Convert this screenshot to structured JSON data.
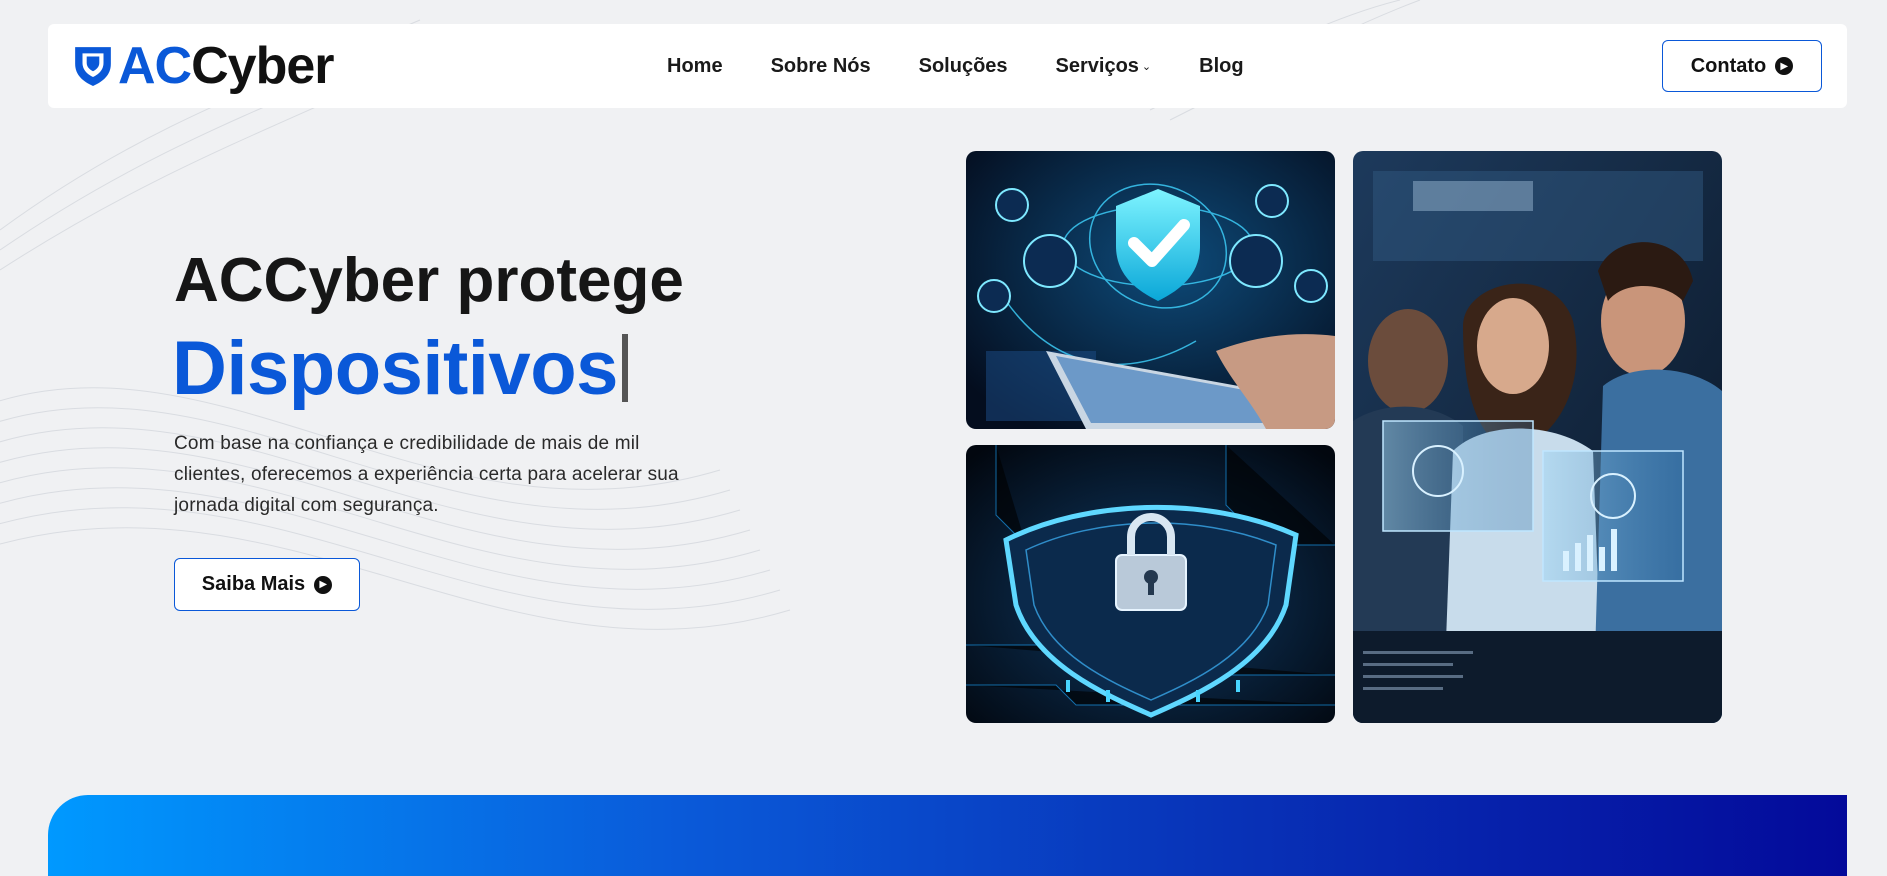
{
  "brand": {
    "prefix": "AC",
    "suffix": "Cyber",
    "accent": "#0a58d8"
  },
  "nav": {
    "items": [
      {
        "label": "Home"
      },
      {
        "label": "Sobre Nós"
      },
      {
        "label": "Soluções"
      },
      {
        "label": "Serviços",
        "has_dropdown": true
      },
      {
        "label": "Blog"
      }
    ],
    "contact_label": "Contato"
  },
  "hero": {
    "title_line1": "ACCyber protege",
    "title_highlight": "Dispositivos",
    "description": "Com base na confiança e credibilidade de mais de mil clientes, oferecemos a experiência certa para acelerar sua jornada digital com segurança.",
    "cta_label": "Saiba Mais"
  },
  "icons": {
    "logo": "shield-icon",
    "button_arrow": "arrow-circle-right-icon",
    "dropdown": "chevron-down-icon"
  },
  "colors": {
    "background": "#f0f1f3",
    "primary": "#0a58d8",
    "banner_gradient": [
      "#0099ff",
      "#040a9a"
    ]
  }
}
